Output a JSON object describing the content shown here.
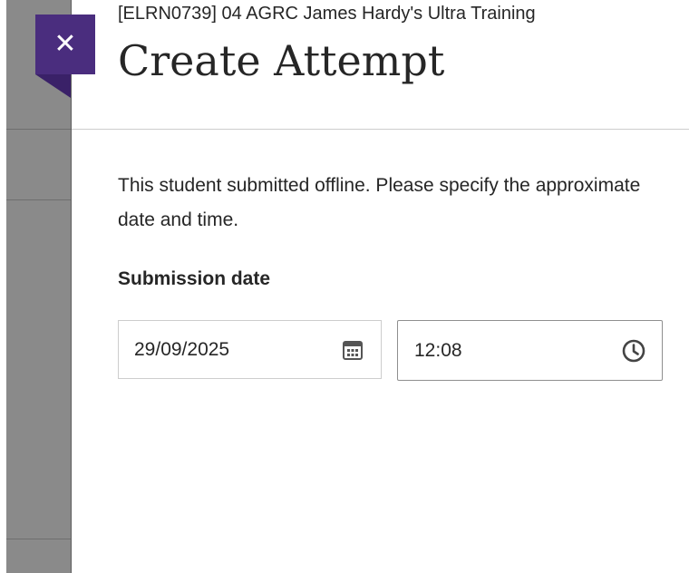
{
  "panel": {
    "course_name": "[ELRN0739] 04 AGRC James Hardy's Ultra Training",
    "title": "Create Attempt",
    "description": "This student submitted offline. Please specify the approximate date and time.",
    "close_icon": "close-icon",
    "close_glyph": "✕"
  },
  "submission": {
    "label": "Submission date",
    "date_value": "29/09/2025",
    "date_icon": "calendar-icon",
    "time_value": "12:08",
    "time_icon": "clock-icon"
  },
  "colors": {
    "accent": "#4a2d7e",
    "text": "#262626",
    "underlay": "#8a8a8a"
  }
}
